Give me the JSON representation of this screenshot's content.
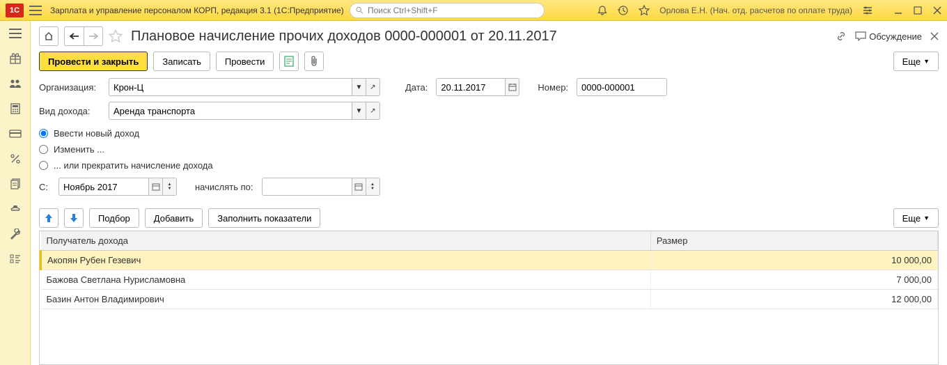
{
  "top": {
    "app_title": "Зарплата и управление персоналом КОРП, редакция 3.1  (1С:Предприятие)",
    "search_placeholder": "Поиск Ctrl+Shift+F",
    "user": "Орлова Е.Н. (Нач. отд. расчетов по оплате труда)"
  },
  "doc": {
    "title": "Плановое начисление прочих доходов 0000-000001 от 20.11.2017",
    "discuss": "Обсуждение"
  },
  "toolbar": {
    "post_close": "Провести и закрыть",
    "save": "Записать",
    "post": "Провести",
    "more": "Еще"
  },
  "form": {
    "org_label": "Организация:",
    "org_value": "Крон-Ц",
    "date_label": "Дата:",
    "date_value": "20.11.2017",
    "number_label": "Номер:",
    "number_value": "0000-000001",
    "income_type_label": "Вид дохода:",
    "income_type_value": "Аренда транспорта",
    "radio_new": "Ввести новый доход",
    "radio_change": "Изменить ...",
    "radio_stop": "... или прекратить начисление дохода",
    "from_label": "С:",
    "from_value": "Ноябрь 2017",
    "accrue_to_label": "начислять по:",
    "accrue_to_value": ""
  },
  "table_toolbar": {
    "select": "Подбор",
    "add": "Добавить",
    "fill": "Заполнить показатели",
    "more": "Еще"
  },
  "table": {
    "col_recipient": "Получатель дохода",
    "col_amount": "Размер",
    "rows": [
      {
        "name": "Акопян Рубен Гезевич",
        "amount": "10 000,00",
        "selected": true
      },
      {
        "name": "Бажова Светлана Нурисламовна",
        "amount": "7 000,00",
        "selected": false
      },
      {
        "name": "Базин Антон Владимирович",
        "amount": "12 000,00",
        "selected": false
      }
    ]
  }
}
